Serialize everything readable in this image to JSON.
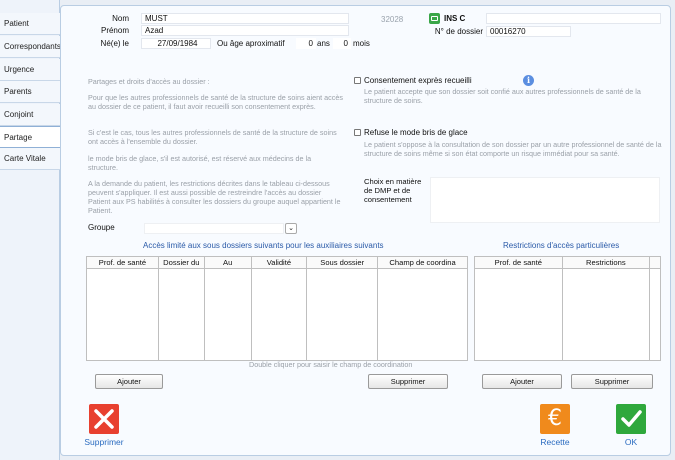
{
  "sidebar": {
    "items": [
      {
        "label": "Patient",
        "active": false
      },
      {
        "label": "Correspondants",
        "active": false
      },
      {
        "label": "Urgence",
        "active": false
      },
      {
        "label": "Parents",
        "active": false
      },
      {
        "label": "Conjoint",
        "active": false
      },
      {
        "label": "Partage",
        "active": true
      },
      {
        "label": "Carte Vitale",
        "active": false
      }
    ]
  },
  "identity": {
    "nom_label": "Nom",
    "nom_value": "MUST",
    "prenom_label": "Prénom",
    "prenom_value": "Azad",
    "ne_label": "Né(e) le",
    "ne_value": "27/09/1984",
    "age_label": "Ou âge aproximatif",
    "age_years": "0",
    "age_years_unit": "ans",
    "age_months": "0",
    "age_months_unit": "mois",
    "code": "32028",
    "ins_label": "INS C",
    "ins_value": "",
    "dossier_label": "N° de dossier",
    "dossier_value": "00016270"
  },
  "partage": {
    "heading": "Partages et droits d'accès au dossier :",
    "p1": "Pour que les autres professionnels de santé de la structure de soins aient accès au dossier de ce patient, il faut avoir recueilli son consentement exprès.",
    "p2": "Si c'est le cas, tous les autres professionnels de santé de la structure de soins ont accès à l'ensemble du dossier.",
    "p3": "le mode bris de glace, s'il est autorisé, est réservé aux médecins de la structure.",
    "p4": "A la demande du patient, les restrictions décrites dans le tableau ci-dessous peuvent s'appliquer. Il est aussi possible de restreindre l'accès au dossier Patient aux PS habilités à consulter les dossiers du groupe auquel appartient le Patient.",
    "consent_label": "Consentement exprès recueilli",
    "consent_desc": "Le patient accepte que son dossier soit confié  aux autres professionnels de santé de la structure de soins.",
    "refuse_label": "Refuse le mode bris de glace",
    "refuse_desc": "Le patient s'oppose à la consultation de son dossier par un autre professionnel de santé de la structure de soins même si son état comporte un risque immédiat pour sa santé.",
    "choix_label": "Choix en matière de DMP et de consentement",
    "choix_value": "",
    "groupe_label": "Groupe",
    "groupe_value": ""
  },
  "access_table": {
    "title": "Accès limité aux sous dossiers suivants pour les auxiliaires suivants",
    "columns": [
      "Prof. de santé",
      "Dossier du",
      "Au",
      "Validité",
      "Sous dossier",
      "Champ de coordina"
    ],
    "rows": [],
    "hint": "Double cliquer pour saisir le champ de coordination",
    "add_label": "Ajouter",
    "delete_label": "Supprimer"
  },
  "restrictions_table": {
    "title": "Restrictions d'accès particulières",
    "columns": [
      "Prof. de santé",
      "Restrictions"
    ],
    "rows": [],
    "add_label": "Ajouter",
    "delete_label": "Supprimer"
  },
  "actions": {
    "supprimer_label": "Supprimer",
    "recette_label": "Recette",
    "ok_label": "OK"
  },
  "colors": {
    "accent_blue": "#2a6bc0",
    "delete_red": "#e8402f",
    "recette_orange": "#f08a1c",
    "ok_green": "#2fa83c"
  }
}
